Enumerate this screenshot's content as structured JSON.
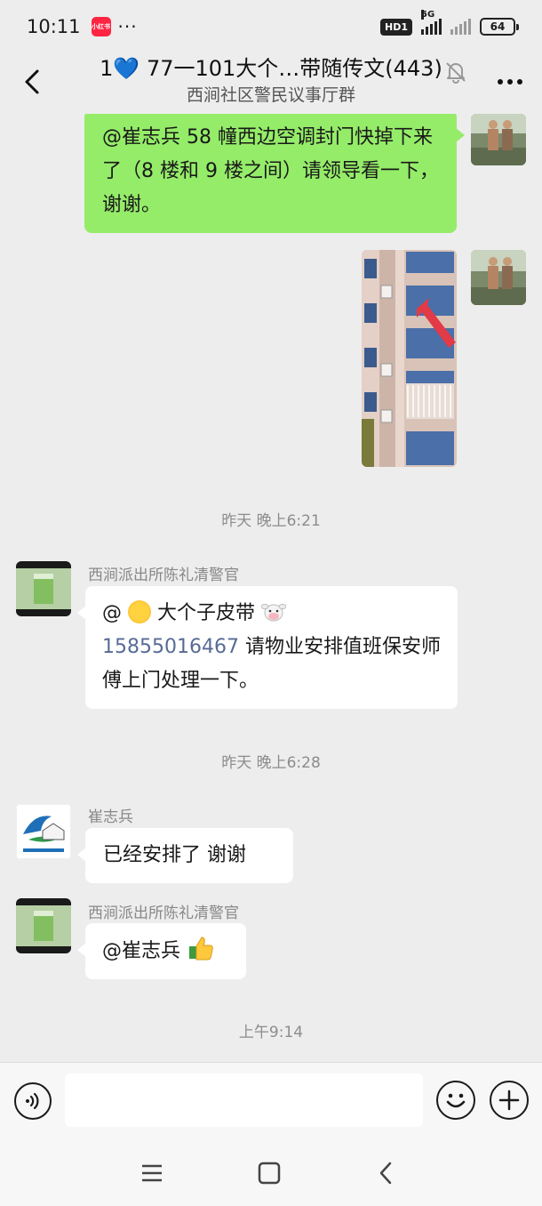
{
  "status_bar": {
    "time": "10:11",
    "app_badge": "小红书",
    "dots": "···",
    "hd": "HD1",
    "network": "5G",
    "battery": "64"
  },
  "header": {
    "title": "1💙 77一101大个…带随传文(443)",
    "subtitle": "西涧社区警民议事厅群"
  },
  "messages": {
    "m1_text": "@崔志兵 58 幢西边空调封门快掉下来了（8 楼和 9 楼之间）请领导看一下，谢谢。",
    "ts1": "昨天 晚上6:21",
    "m3_sender": "西涧派出所陈礼清警官",
    "m3_at": "@",
    "m3_name": " 大个子皮带",
    "m3_phone": "15855016467",
    "m3_rest": " 请物业安排值班保安师傅上门处理一下。",
    "ts2": "昨天 晚上6:28",
    "m4_sender": "崔志兵",
    "m4_text": "已经安排了  谢谢",
    "m5_sender": "西涧派出所陈礼清警官",
    "m5_text": "@崔志兵 ",
    "ts3": "上午9:14"
  },
  "colors": {
    "green_bubble": "#95ec69",
    "chat_bg": "#ededed",
    "link": "#576b95"
  },
  "icons": {
    "back": "chevron-left-icon",
    "mute": "bell-off-icon",
    "more": "more-icon",
    "voice": "voice-icon",
    "emoji": "smiley-icon",
    "plus": "plus-icon"
  }
}
